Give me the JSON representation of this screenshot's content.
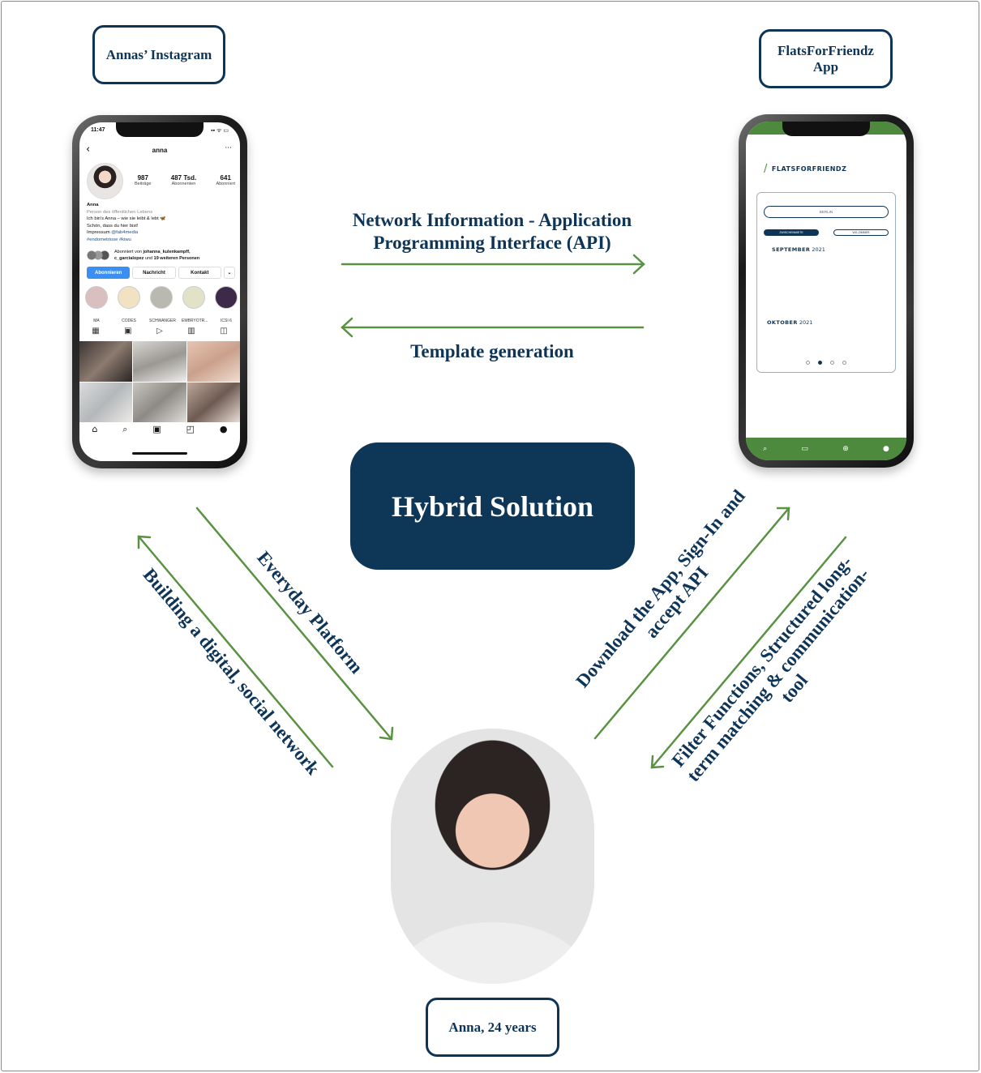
{
  "boxes": {
    "instagram": "Annas’ Instagram",
    "ffz_line1": "FlatsForFriendz",
    "ffz_line2": "App",
    "anna": "Anna, 24 years"
  },
  "center": "Hybrid Solution",
  "edges": {
    "api_line1": "Network Information - Application",
    "api_line2": "Programming Interface (API)",
    "template": "Template generation",
    "everyday": "Everyday Platform",
    "building": "Building a digital, social network",
    "download_line1": "Download the App, Sign-In and",
    "download_line2": "accept API",
    "filter_line1": "Filter Functions, Structured long-",
    "filter_line2": "term matching & communication-",
    "filter_line3": "tool"
  },
  "instagram_screen": {
    "time": "11:47",
    "status_right": "▪▪ ᯤ ▭",
    "username": "anna",
    "posts": "987",
    "posts_label": "Beiträge",
    "followers": "487 Tsd.",
    "followers_label": "Abonnenten",
    "following": "641",
    "following_label": "Abonniert",
    "name": "Anna",
    "category": "Person des öffentlichen Lebens",
    "bio1": "Ich bin's Anna – wie sie leibt & lebt 🦋",
    "bio2": "Schön, dass du hier bist!",
    "bio3_prefix": "Impressum",
    "bio3_link": "@fab4media",
    "bio4": "#endometriose #kiwu",
    "followed_prefix": "Abonniert von",
    "followed_name1": "johanna_kulenkampff,",
    "followed_name2": "c_garcialopez",
    "followed_mid": "und",
    "followed_rest": "19 weiteren Personen",
    "btn_follow": "Abonnieren",
    "btn_message": "Nachricht",
    "btn_contact": "Kontakt",
    "btn_more": "⌄",
    "highlights": [
      {
        "label": "MA",
        "color": "#d9bfc0"
      },
      {
        "label": "CODES",
        "color": "#f1e2c4"
      },
      {
        "label": "SCHWANGER",
        "color": "#b9b9b1"
      },
      {
        "label": "EMBRYOTR...",
        "color": "#e1e2c8"
      },
      {
        "label": "ICSI 6",
        "color": "#3c2a48"
      }
    ]
  },
  "ffz_screen": {
    "logo": "FLATSFORFRIENDZ",
    "search": "BERLIN",
    "pill_a": "ZWISCHENMIETE",
    "pill_b": "WG-ZIMMER",
    "month1": "SEPTEMBER",
    "month1_year": "2021",
    "month2": "OKTOBER",
    "month2_year": "2021"
  },
  "colors": {
    "navy": "#0d3657",
    "green": "#4e8a3e",
    "arrow_green": "#5a9243"
  }
}
